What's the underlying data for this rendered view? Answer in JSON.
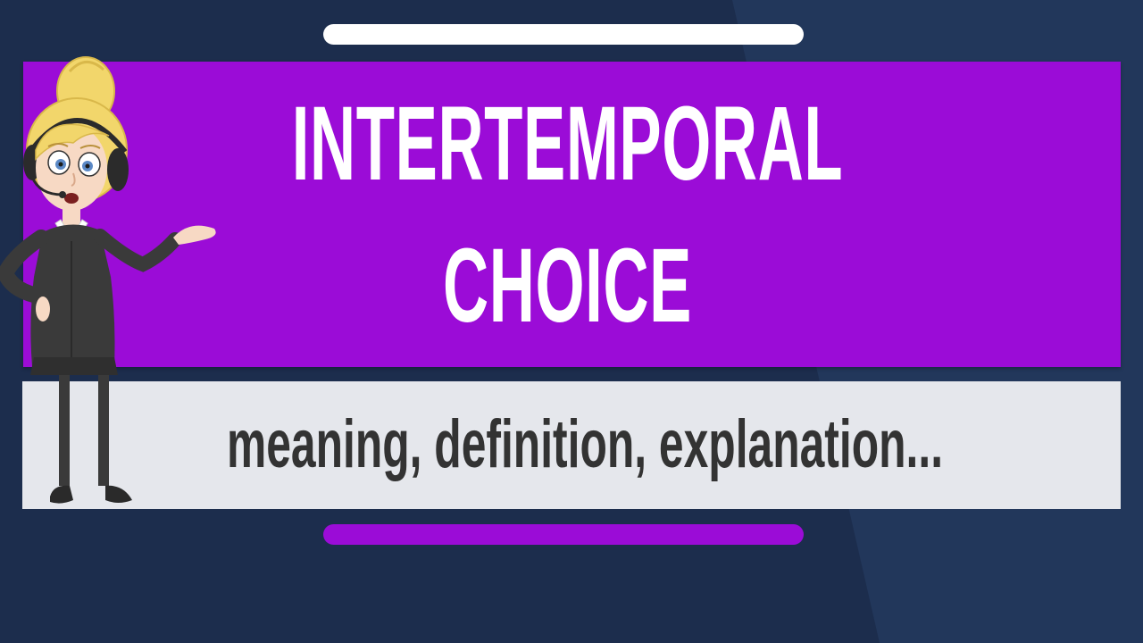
{
  "colors": {
    "background": "#1c2d4d",
    "background_facet": "#22375b",
    "accent_purple": "#9b0cd7",
    "white": "#ffffff",
    "subtitle_panel": "#e5e7ec",
    "subtitle_text": "#333333"
  },
  "title": {
    "line1": "INTERTEMPORAL",
    "line2": "CHOICE"
  },
  "subtitle": "meaning, definition, explanation...",
  "presenter": {
    "icon": "cartoon-presenter-woman"
  }
}
